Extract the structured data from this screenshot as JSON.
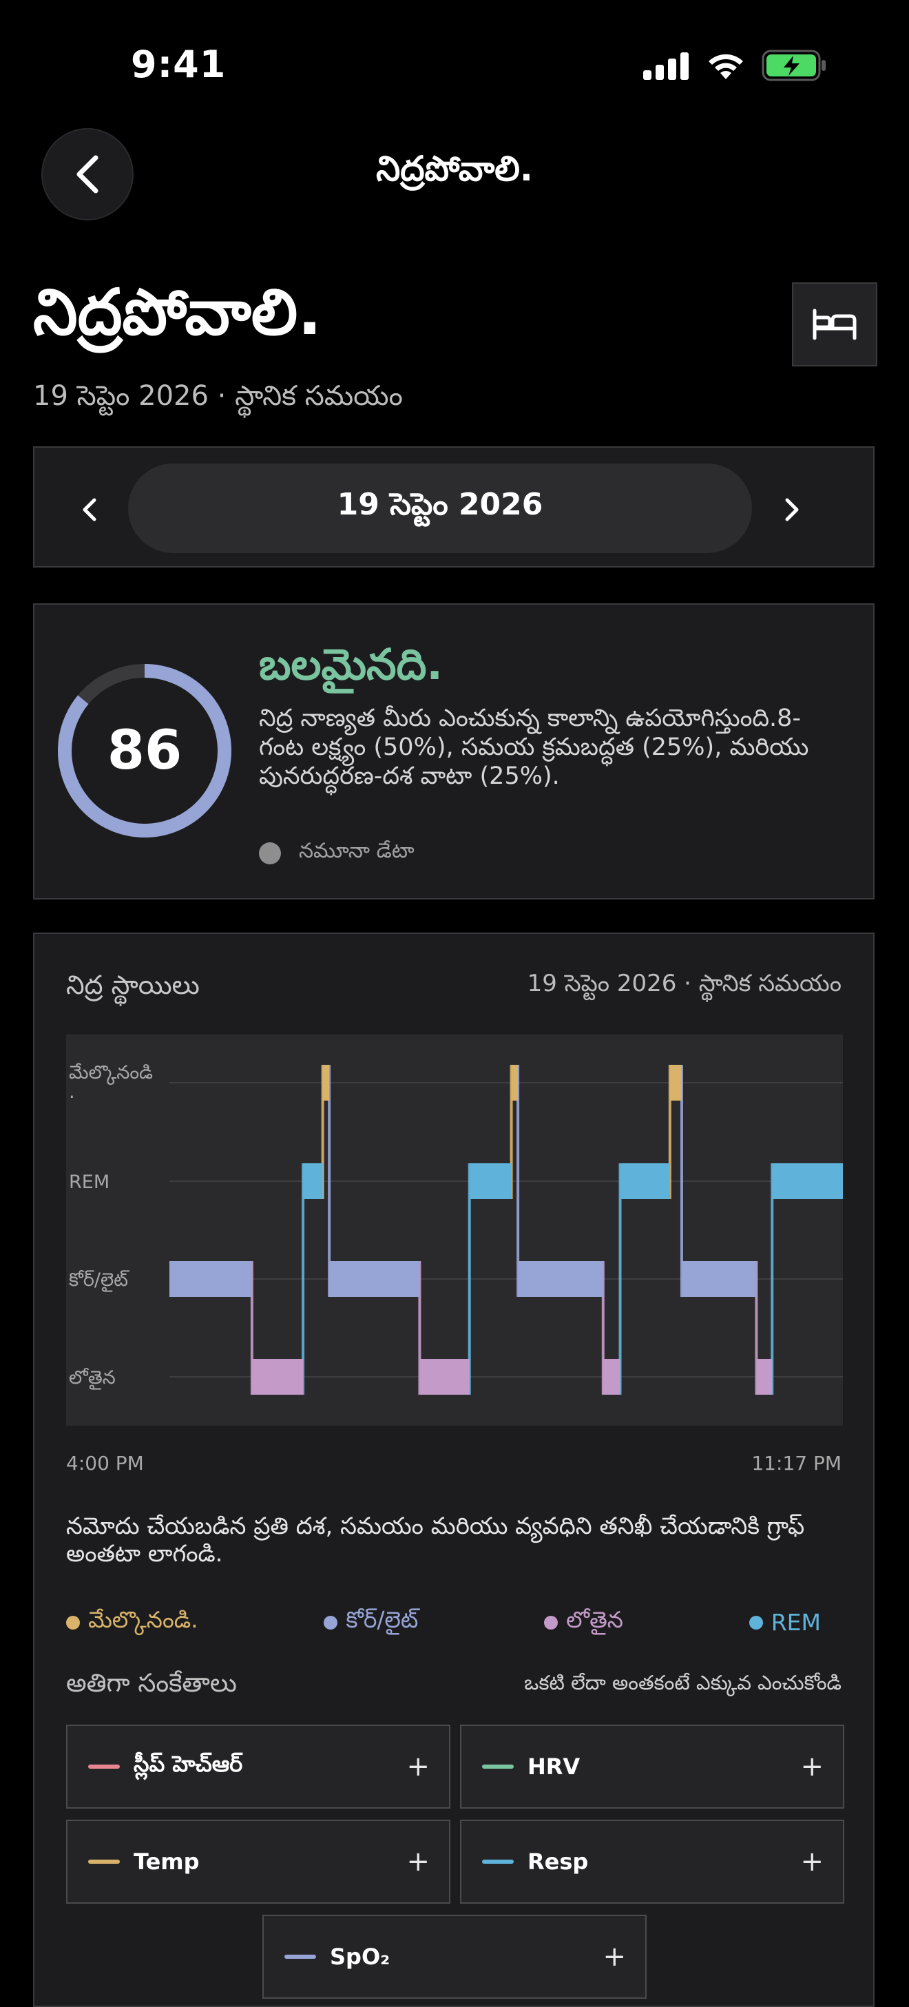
{
  "status": {
    "time": "9:41"
  },
  "nav": {
    "title": "నిద్రపోవాలి."
  },
  "header": {
    "title": "నిద్రపోవాలి.",
    "subtitle": "19 సెప్టెం 2026 · స్థానిక సమయం"
  },
  "date_nav": {
    "date": "19 సెప్టెం 2026"
  },
  "score": {
    "value": "86",
    "fraction": 0.86,
    "label": "బలమైనది.",
    "description": "నిద్ర నాణ్యత మీరు ఎంచుకున్న కాలాన్ని ఉపయోగిస్తుంది.8- గంట లక్ష్యం (50%), సమయ క్రమబద్ధత (25%), మరియు పునరుద్ధరణ-దశ వాటా (25%).",
    "sample_label": "నమూనా డేటా"
  },
  "stages": {
    "title": "నిద్ర స్థాయిలు",
    "date": "19 సెప్టెం 2026 · స్థానిక సమయం",
    "hint": "నమోదు చేయబడిన ప్రతి దశ, సమయం మరియు వ్యవధిని తనిఖీ చేయడానికి గ్రాఫ్ అంతటా లాగండి.",
    "legend": [
      {
        "label": "మేల్కొనండి.",
        "color": "#d9b36a"
      },
      {
        "label": "కోర్/లైట్",
        "color": "#97a5d6"
      },
      {
        "label": "లోతైన",
        "color": "#c49bc8"
      },
      {
        "label": "REM",
        "color": "#5fb3da"
      }
    ]
  },
  "chart_data": {
    "type": "hypnogram",
    "y_levels": [
      "మేల్కొనండి\n.",
      "REM",
      "కోర్/లైట్",
      "లోతైన"
    ],
    "x_start": "4:00 PM",
    "x_end": "11:17 PM",
    "segments": [
      {
        "stage": "core",
        "start": "4:00 PM",
        "end": "5:03 PM"
      },
      {
        "stage": "deep",
        "start": "5:03 PM",
        "end": "5:42 PM"
      },
      {
        "stage": "rem",
        "start": "5:42 PM",
        "end": "5:57 PM"
      },
      {
        "stage": "awake",
        "start": "5:57 PM",
        "end": "6:02 PM"
      },
      {
        "stage": "core",
        "start": "6:02 PM",
        "end": "7:11 PM"
      },
      {
        "stage": "deep",
        "start": "7:11 PM",
        "end": "7:49 PM"
      },
      {
        "stage": "rem",
        "start": "7:49 PM",
        "end": "8:21 PM"
      },
      {
        "stage": "awake",
        "start": "8:21 PM",
        "end": "8:26 PM"
      },
      {
        "stage": "core",
        "start": "8:26 PM",
        "end": "9:31 PM"
      },
      {
        "stage": "deep",
        "start": "9:31 PM",
        "end": "9:44 PM"
      },
      {
        "stage": "rem",
        "start": "9:44 PM",
        "end": "10:22 PM"
      },
      {
        "stage": "awake",
        "start": "10:22 PM",
        "end": "10:31 PM"
      },
      {
        "stage": "core",
        "start": "10:31 PM",
        "end": "11:28 PM"
      },
      {
        "stage": "deep",
        "start": "11:28 PM",
        "end": "11:40 PM"
      },
      {
        "stage": "rem",
        "start": "11:40 PM",
        "end": "12:34 AM"
      }
    ]
  },
  "signals": {
    "title": "అతిగా సంకేతాలు",
    "note": "ఒకటి లేదా అంతకంటే ఎక్కువ ఎంచుకోండి",
    "items": [
      {
        "label": "స్లీప్ హెచ్ఆర్",
        "color": "#e8868f",
        "action": "+"
      },
      {
        "label": "HRV",
        "color": "#7bc4a0",
        "action": "+"
      },
      {
        "label": "Temp",
        "color": "#d9b36a",
        "action": "+"
      },
      {
        "label": "Resp",
        "color": "#5fb3da",
        "action": "+"
      },
      {
        "label": "SpO₂",
        "color": "#97a5d6",
        "action": "+"
      }
    ]
  }
}
